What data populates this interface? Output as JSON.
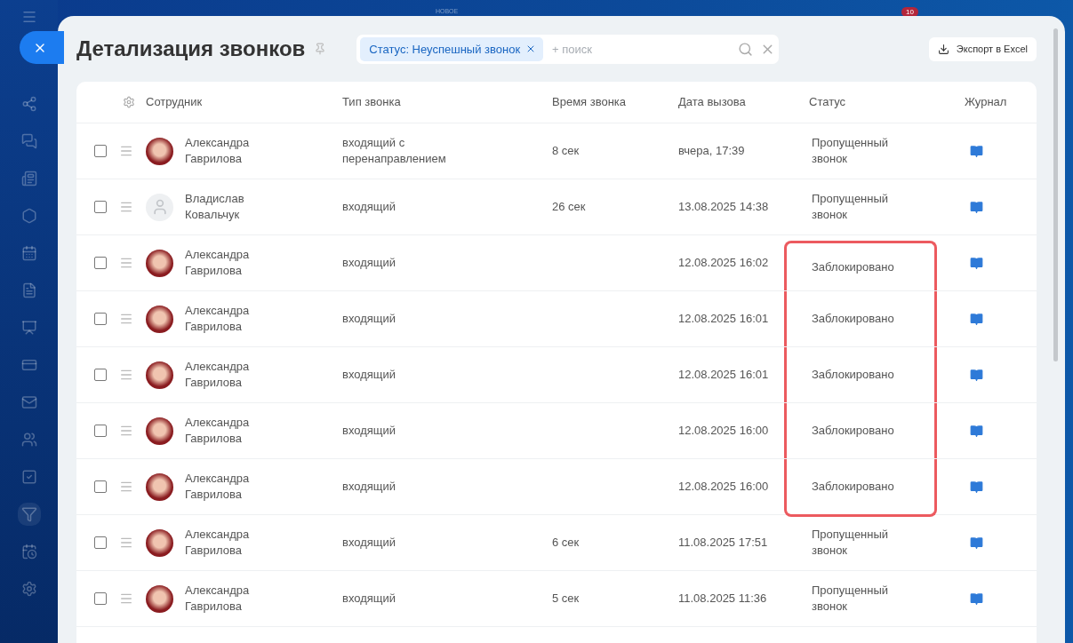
{
  "topbar": {
    "label": "НОВОЕ",
    "badge": "10"
  },
  "page": {
    "title": "Детализация звонков"
  },
  "filter": {
    "chip": "Статус: Неуспешный звонок",
    "placeholder": "+ поиск"
  },
  "export_button": "Экспорт в Excel",
  "table": {
    "columns": [
      "Сотрудник",
      "Тип звонка",
      "Время звонка",
      "Дата вызова",
      "Статус",
      "Журнал"
    ],
    "rows": [
      {
        "checked": false,
        "employee": "Александра Гаврилова",
        "photo": true,
        "type": "входящий с перенаправлением",
        "duration": "8 сек",
        "date": "вчера, 17:39",
        "status": "Пропущенный звонок",
        "highlighted": false
      },
      {
        "checked": false,
        "employee": "Владислав Ковальчук",
        "photo": false,
        "type": "входящий",
        "duration": "26 сек",
        "date": "13.08.2025 14:38",
        "status": "Пропущенный звонок",
        "highlighted": false
      },
      {
        "checked": false,
        "employee": "Александра Гаврилова",
        "photo": true,
        "type": "входящий",
        "duration": "",
        "date": "12.08.2025 16:02",
        "status": "Заблокировано",
        "highlighted": true
      },
      {
        "checked": false,
        "employee": "Александра Гаврилова",
        "photo": true,
        "type": "входящий",
        "duration": "",
        "date": "12.08.2025 16:01",
        "status": "Заблокировано",
        "highlighted": true
      },
      {
        "checked": false,
        "employee": "Александра Гаврилова",
        "photo": true,
        "type": "входящий",
        "duration": "",
        "date": "12.08.2025 16:01",
        "status": "Заблокировано",
        "highlighted": true
      },
      {
        "checked": false,
        "employee": "Александра Гаврилова",
        "photo": true,
        "type": "входящий",
        "duration": "",
        "date": "12.08.2025 16:00",
        "status": "Заблокировано",
        "highlighted": true
      },
      {
        "checked": false,
        "employee": "Александра Гаврилова",
        "photo": true,
        "type": "входящий",
        "duration": "",
        "date": "12.08.2025 16:00",
        "status": "Заблокировано",
        "highlighted": true
      },
      {
        "checked": false,
        "employee": "Александра Гаврилова",
        "photo": true,
        "type": "входящий",
        "duration": "6 сек",
        "date": "11.08.2025 17:51",
        "status": "Пропущенный звонок",
        "highlighted": false
      },
      {
        "checked": false,
        "employee": "Александра Гаврилова",
        "photo": true,
        "type": "входящий",
        "duration": "5 сек",
        "date": "11.08.2025 11:36",
        "status": "Пропущенный звонок",
        "highlighted": false
      }
    ]
  }
}
